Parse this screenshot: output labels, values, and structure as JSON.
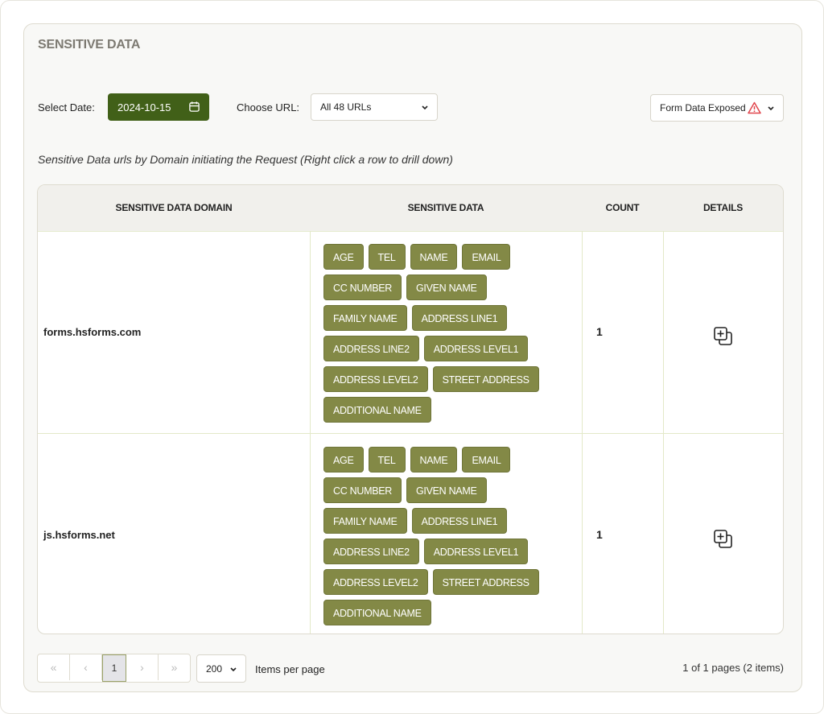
{
  "header": {
    "title": "SENSITIVE DATA"
  },
  "filters": {
    "date_label": "Select Date:",
    "date_value": "2024-10-15",
    "url_label": "Choose URL:",
    "url_value": "All 48 URLs",
    "exposure_value": "Form Data Exposed",
    "icons": {
      "date": "calendar-icon",
      "exposure": "warning-triangle-icon",
      "dropdown": "chevron-down-icon"
    },
    "colors": {
      "date_button": "#416018",
      "warning": "#e0444b"
    }
  },
  "subtitle": "Sensitive Data urls by Domain initiating the Request (Right click a row to drill down)",
  "table": {
    "columns": [
      "SENSITIVE DATA DOMAIN",
      "SENSITIVE DATA",
      "COUNT",
      "DETAILS"
    ],
    "tag_color": "#838946",
    "rows": [
      {
        "domain": "forms.hsforms.com",
        "tags": [
          "AGE",
          "TEL",
          "NAME",
          "EMAIL",
          "CC NUMBER",
          "GIVEN NAME",
          "FAMILY NAME",
          "ADDRESS LINE1",
          "ADDRESS LINE2",
          "ADDRESS LEVEL1",
          "ADDRESS LEVEL2",
          "STREET ADDRESS",
          "ADDITIONAL NAME"
        ],
        "count": "1",
        "details_icon": "expand-details-icon"
      },
      {
        "domain": "js.hsforms.net",
        "tags": [
          "AGE",
          "TEL",
          "NAME",
          "EMAIL",
          "CC NUMBER",
          "GIVEN NAME",
          "FAMILY NAME",
          "ADDRESS LINE1",
          "ADDRESS LINE2",
          "ADDRESS LEVEL1",
          "ADDRESS LEVEL2",
          "STREET ADDRESS",
          "ADDITIONAL NAME"
        ],
        "count": "1",
        "details_icon": "expand-details-icon"
      }
    ]
  },
  "pagination": {
    "first": "«",
    "prev": "‹",
    "current_page": "1",
    "next": "›",
    "last": "»",
    "per_page_value": "200",
    "per_page_label": "Items per page",
    "info": "1 of 1 pages (2 items)"
  }
}
